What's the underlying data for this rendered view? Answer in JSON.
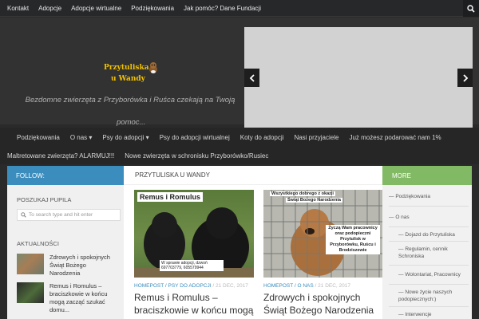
{
  "topnav": {
    "items": [
      "Kontakt",
      "Adopcje",
      "Adopcje wirtualne",
      "Podziękowania",
      "Jak pomóc? Dane Fundacji"
    ],
    "search_icon": "search-icon"
  },
  "header": {
    "logo_line1": "Przytuliska",
    "logo_line2": "u Wandy",
    "tagline_line1": "Bezdomne zwierzęta z Przyborówka i Ruśca czekają na Twoją",
    "tagline_line2": "pomoc..."
  },
  "slider": {
    "prev_icon": "chevron-left-icon",
    "next_icon": "chevron-right-icon"
  },
  "mainnav": {
    "row1": [
      "Podziękowania",
      "O nas ▾",
      "Psy do adopcji ▾",
      "Psy do adopcji wirtualnej",
      "Koty do adopcji",
      "Nasi przyjaciele",
      "Już możesz podarować nam 1%"
    ],
    "row2": [
      "Maltretowane zwierzęta? ALARMUJ!!!",
      "Nowe zwierzęta w schronisku Przyborówko/Rusiec"
    ]
  },
  "follow": {
    "label": "FOLLOW:"
  },
  "center_header": {
    "label": "PRZYTULISKA U WANDY"
  },
  "more": {
    "label": "MORE"
  },
  "left": {
    "search_title": "POSZUKAJ PUPILA",
    "search_placeholder": "To search type and hit enter",
    "recent_title": "AKTUALNOŚCI",
    "recent": [
      {
        "title": "Zdrowych i spokojnych Świąt Bożego Narodzenia"
      },
      {
        "title": "Remus i Romulus – braciszkowie w końcu mogą zacząć szukać domu..."
      }
    ]
  },
  "posts": [
    {
      "img_title": "Remus i Romulus",
      "img_caption": "W sprawie adopcji, dzwoń 697703779, 605579944",
      "categories": "HOMEPOST / PSY DO ADOPCJI",
      "date": "/ 21 DEC, 2017",
      "title": "Remus i Romulus – braciszkowie w końcu mogą"
    },
    {
      "img_line1": "Wszystkiego dobrego z okazji",
      "img_line2": "Świąt Bożego Narodzenia",
      "img_text": "Życzą Wam pracownicy oraz podopieczni Przytulisk w Przyborówku, Ruścu i Brodziszewie",
      "categories": "HOMEPOST / O NAS",
      "date": "/ 21 DEC, 2017",
      "title": "Zdrowych i spokojnych Świąt Bożego Narodzenia"
    }
  ],
  "right": {
    "items": [
      "Podziękowania",
      "O nas",
      "Dojazd do Przytuliska",
      "Regulamin, cennik Schroniska",
      "Wolontariat, Pracownicy",
      "Nowe życie naszych podopiecznych:)",
      "Interwencje"
    ]
  },
  "colors": {
    "follow_bg": "#3b8dbd",
    "more_bg": "#82b965",
    "logo_yellow": "#f2c200"
  }
}
